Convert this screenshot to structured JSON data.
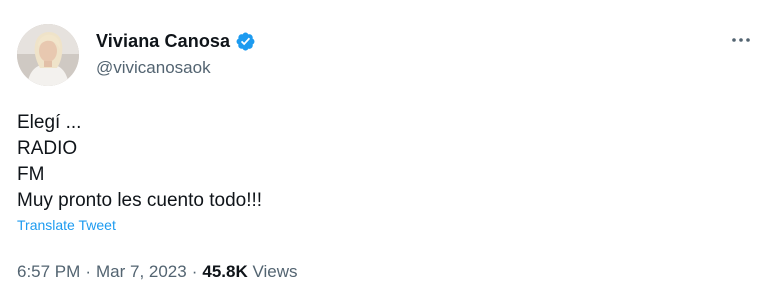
{
  "author": {
    "display_name": "Viviana Canosa",
    "handle": "@vivicanosaok",
    "verified_color": "#1d9bf0"
  },
  "tweet": {
    "lines": [
      "Elegí ...",
      "RADIO",
      "FM",
      "Muy pronto les cuento todo!!!"
    ],
    "translate_label": "Translate Tweet"
  },
  "meta": {
    "time": "6:57 PM",
    "separator": "·",
    "date": "Mar 7, 2023",
    "views_count": "45.8K",
    "views_label": "Views"
  },
  "icons": {
    "more": "more-horizontal-icon",
    "verified": "verified-badge-icon"
  }
}
